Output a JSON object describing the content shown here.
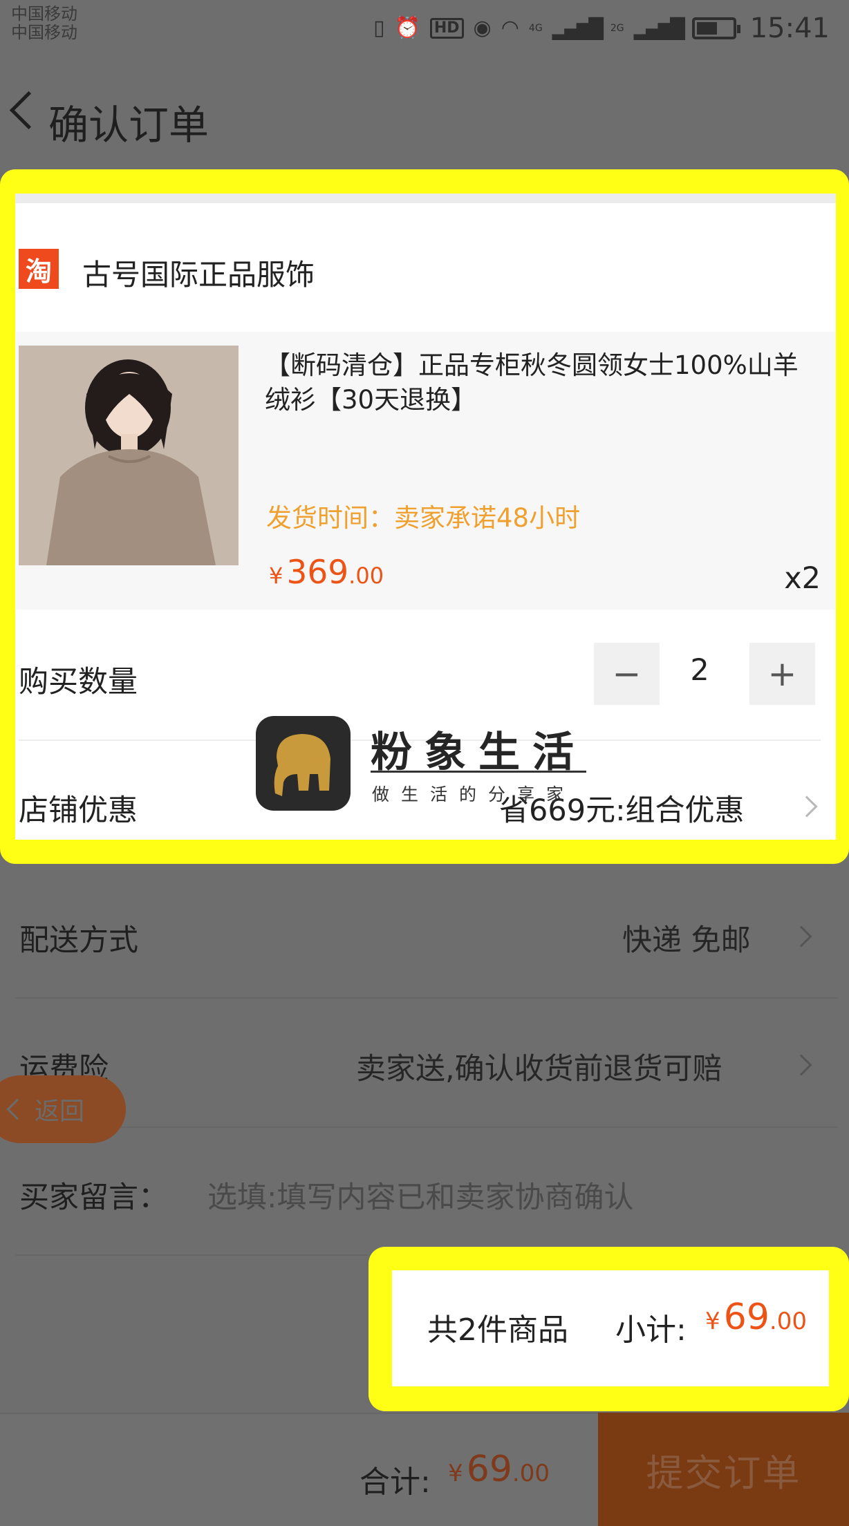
{
  "status_bar": {
    "carrier_1": "中国移动",
    "carrier_2": "中国移动",
    "network_1": "4G",
    "network_2": "2G",
    "battery_level": 0.55,
    "time": "15:41"
  },
  "header": {
    "title": "确认订单"
  },
  "order": {
    "shop_badge": "淘",
    "shop_name": "古号国际正品服饰",
    "product": {
      "image_icon": "product-photo",
      "title": "【断码清仓】正品专柜秋冬圆领女士100%山羊绒衫【30天退换】",
      "ship_time": "发货时间：卖家承诺48小时",
      "price_currency": "¥",
      "price_int": "369",
      "price_dec": ".00",
      "quantity_badge": "x2"
    },
    "quantity": {
      "label": "购买数量",
      "minus": "−",
      "value": "2",
      "plus": "+"
    },
    "shop_discount": {
      "label": "店铺优惠",
      "value": "省669元:组合优惠"
    }
  },
  "watermark": {
    "title": "粉象生活",
    "subtitle": "做生活的分享家"
  },
  "delivery": {
    "label": "配送方式",
    "value": "快递 免邮"
  },
  "shipping_insurance": {
    "label": "运费险",
    "value": "卖家送,确认收货前退货可赔"
  },
  "floating_back": {
    "label": "返回"
  },
  "buyer_message": {
    "label": "买家留言：",
    "placeholder": "选填:填写内容已和卖家协商确认"
  },
  "subtotal": {
    "count_text": "共2件商品",
    "label": "小计:",
    "currency": "¥",
    "int": "69",
    "dec": ".00"
  },
  "bottom_bar": {
    "total_label": "合计:",
    "currency": "¥",
    "int": "69",
    "dec": ".00",
    "submit_label": "提交订单"
  },
  "colors": {
    "highlight": "#ffff16",
    "price_orange": "#ee5316",
    "ship_time_orange": "#f0a02e",
    "taobao_red": "#ee4a1d",
    "dim_overlay": "#6e6e6e"
  }
}
